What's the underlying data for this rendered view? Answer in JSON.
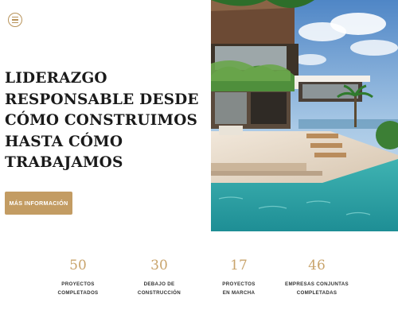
{
  "header": {
    "menu_icon": "hamburger-menu-icon",
    "accent_color": "#c39c63"
  },
  "hero": {
    "title": "LIDERAZGO\nRESPONSABLE DESDE\nCÓMO CONSTRUIMOS\nHASTA CÓMO\nTRABAJAMOS",
    "cta_label": "MÁS INFORMACIÓN"
  },
  "stats": [
    {
      "value": "50",
      "label_line1": "PROYECTOS",
      "label_line2": "COMPLETADOS"
    },
    {
      "value": "30",
      "label_line1": "DEBAJO DE",
      "label_line2": "CONSTRUCCIÓN"
    },
    {
      "value": "17",
      "label_line1": "PROYECTOS",
      "label_line2": "EN MARCHA"
    },
    {
      "value": "46",
      "label_line1": "EMPRESAS CONJUNTAS",
      "label_line2": "COMPLETADAS"
    }
  ]
}
